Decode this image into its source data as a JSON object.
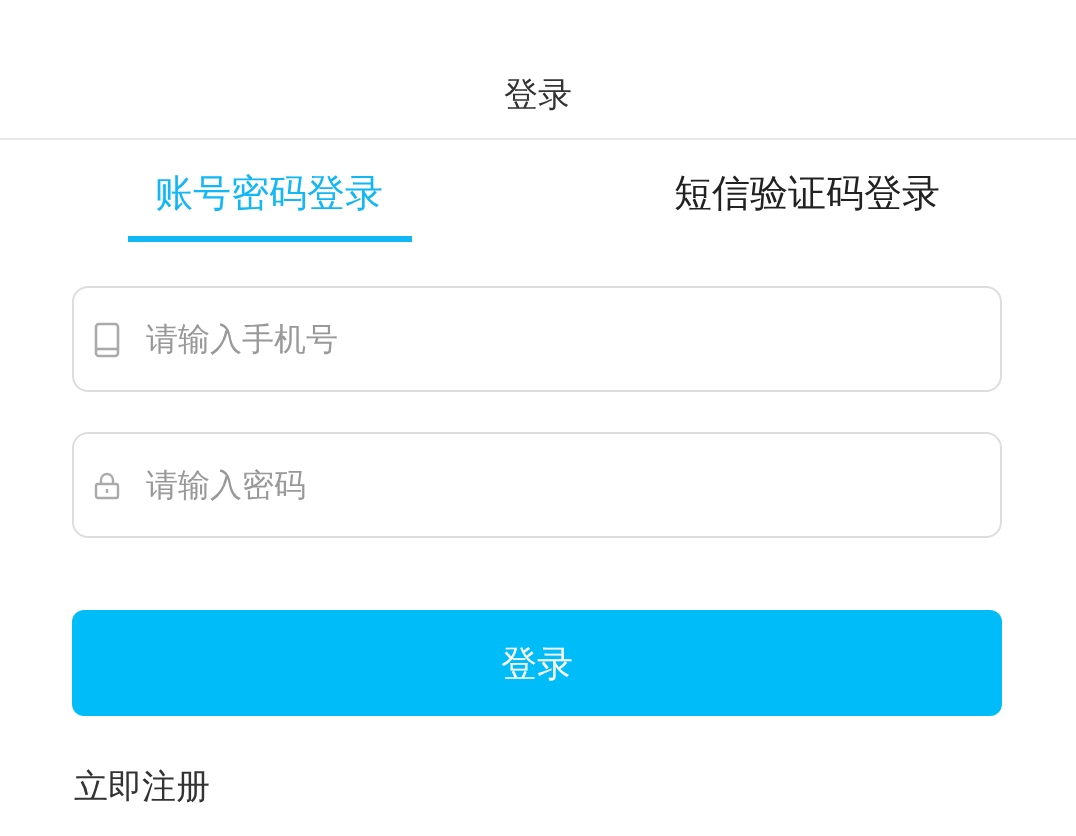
{
  "header": {
    "title": "登录"
  },
  "tabs": [
    {
      "label": "账号密码登录",
      "selected": true
    },
    {
      "label": "短信验证码登录",
      "selected": false
    }
  ],
  "fields": [
    {
      "kind": "phone",
      "placeholder": "请输入手机号"
    },
    {
      "kind": "password",
      "placeholder": "请输入密码"
    }
  ],
  "submit_button": "登录",
  "register_link": "立即注册"
}
